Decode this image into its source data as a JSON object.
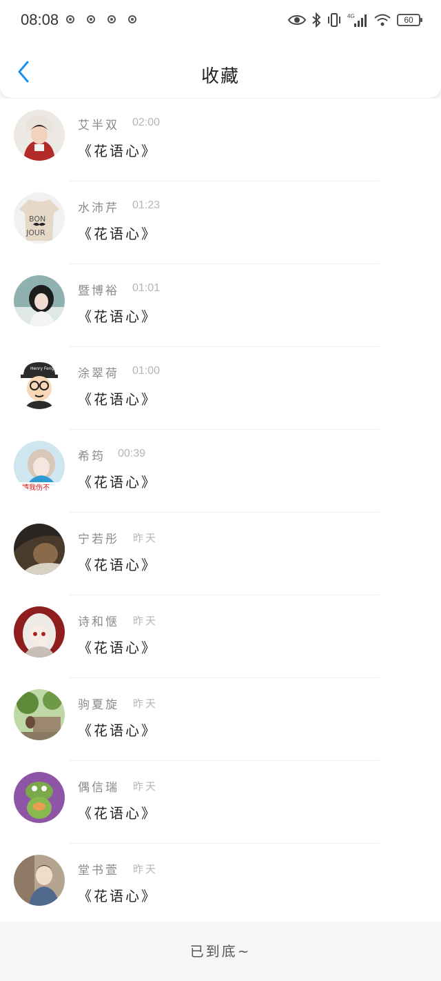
{
  "status_bar": {
    "time": "08:08",
    "network": "4G",
    "battery": "60",
    "icons": [
      "notification-icon",
      "notification-icon",
      "notification-icon",
      "notification-icon",
      "eye-icon",
      "bluetooth-icon",
      "vibrate-icon",
      "signal-icon",
      "wifi-icon",
      "battery-icon"
    ]
  },
  "header": {
    "title": "收藏",
    "back_icon": "chevron-left-icon"
  },
  "colors": {
    "accent": "#1a8ff2",
    "name": "#8a8a8a",
    "time": "#b5b5b5",
    "background": "#f6f6f7"
  },
  "favorites": [
    {
      "name": "艾半双",
      "time": "02:00",
      "work": "《花语心》"
    },
    {
      "name": "水沛芹",
      "time": "01:23",
      "work": "《花语心》"
    },
    {
      "name": "暨博裕",
      "time": "01:01",
      "work": "《花语心》"
    },
    {
      "name": "涂翠荷",
      "time": "01:00",
      "work": "《花语心》"
    },
    {
      "name": "希筠",
      "time": "00:39",
      "work": "《花语心》"
    },
    {
      "name": "宁若彤",
      "time": "昨天",
      "work": "《花语心》"
    },
    {
      "name": "诗和惬",
      "time": "昨天",
      "work": "《花语心》"
    },
    {
      "name": "驹夏旋",
      "time": "昨天",
      "work": "《花语心》"
    },
    {
      "name": "偶信瑞",
      "time": "昨天",
      "work": "《花语心》"
    },
    {
      "name": "堂书萱",
      "time": "昨天",
      "work": "《花语心》"
    }
  ],
  "avatar_texts": {
    "cap": "Henry\nFeng",
    "shirt_line1": "BON",
    "shirt_line2": "JOUR",
    "banner": "情我伤不"
  },
  "footer": {
    "text": "已到底~"
  }
}
